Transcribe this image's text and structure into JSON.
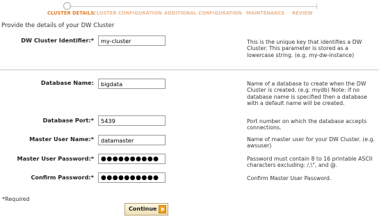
{
  "wizard": {
    "steps": [
      {
        "label": "CLUSTER DETAILS",
        "active": true
      },
      {
        "label": "CLUSTER CONFIGURATION",
        "active": false
      },
      {
        "label": "ADDITIONAL CONFIGURATION",
        "active": false
      },
      {
        "label": "MAINTENANCE",
        "active": false
      },
      {
        "label": "REVIEW",
        "active": false
      }
    ],
    "active_color": "#e07b25",
    "inactive_color": "#e9b893"
  },
  "intro": "Provide the details of your DW Cluster",
  "fields": {
    "cluster_identifier": {
      "label": "DW Cluster Identifier:*",
      "value": "my-cluster",
      "help": "This is the unique key that identifies a DW Cluster. This parameter is stored as a lowercase string. (e.g. my-dw-instance)"
    },
    "database_name": {
      "label": "Database Name:",
      "value": "bigdata",
      "help": "Name of a database to create when the DW Cluster is created. (e.g. mydb) Note: if no database name is specified then a database with a default name will be created."
    },
    "database_port": {
      "label": "Database Port:*",
      "value": "5439",
      "help": "Port number on which the database accepts connections."
    },
    "master_user_name": {
      "label": "Master User Name:*",
      "value": "datamaster",
      "help": "Name of master user for your DW Cluster. (e.g. awsuser)"
    },
    "master_user_password": {
      "label": "Master User Password:*",
      "value": "●●●●●●●●●●",
      "help": "Password must contain 8 to 16 printable ASCII characters excluding: /,\\\", and @."
    },
    "confirm_password": {
      "label": "Confirm Password:*",
      "value": "●●●●●●●●●●",
      "help": "Confirm Master User Password."
    }
  },
  "required_note": "*Required",
  "continue_button": {
    "label": "Continue",
    "icon": "arrow-right-icon"
  }
}
